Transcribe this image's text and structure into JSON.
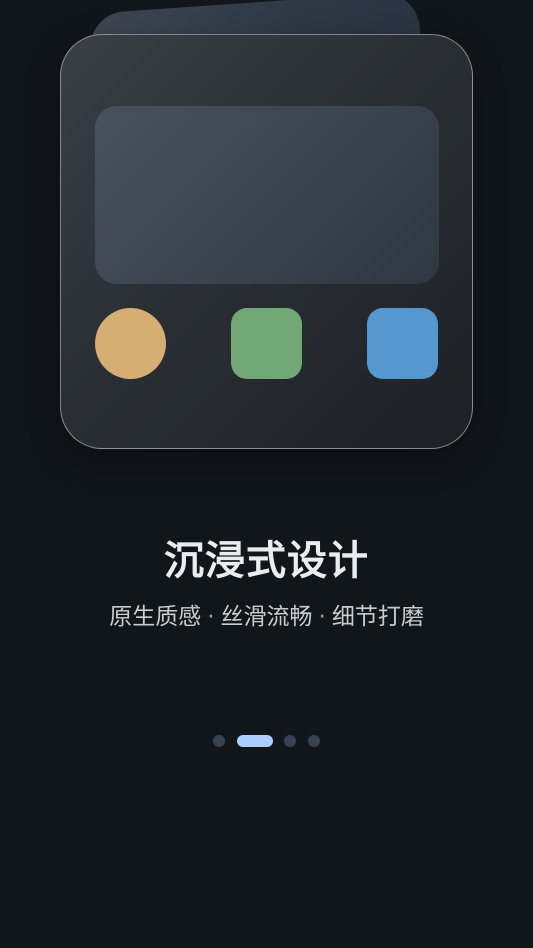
{
  "onboarding": {
    "title": "沉浸式设计",
    "subtitle_parts": [
      "原生质感",
      "丝滑流畅",
      "细节打磨"
    ],
    "subtitle_separator": "·",
    "illustration": {
      "app_icons": [
        {
          "name": "circle-app-icon",
          "color": "#d6ad72",
          "shape": "circle"
        },
        {
          "name": "green-app-icon",
          "color": "#73a876",
          "shape": "rounded-square"
        },
        {
          "name": "blue-app-icon",
          "color": "#5598d0",
          "shape": "rounded-square"
        }
      ]
    },
    "pager": {
      "total_pages": 4,
      "current_page": 2,
      "active_color": "#a9ceff",
      "inactive_color": "#374350"
    }
  }
}
